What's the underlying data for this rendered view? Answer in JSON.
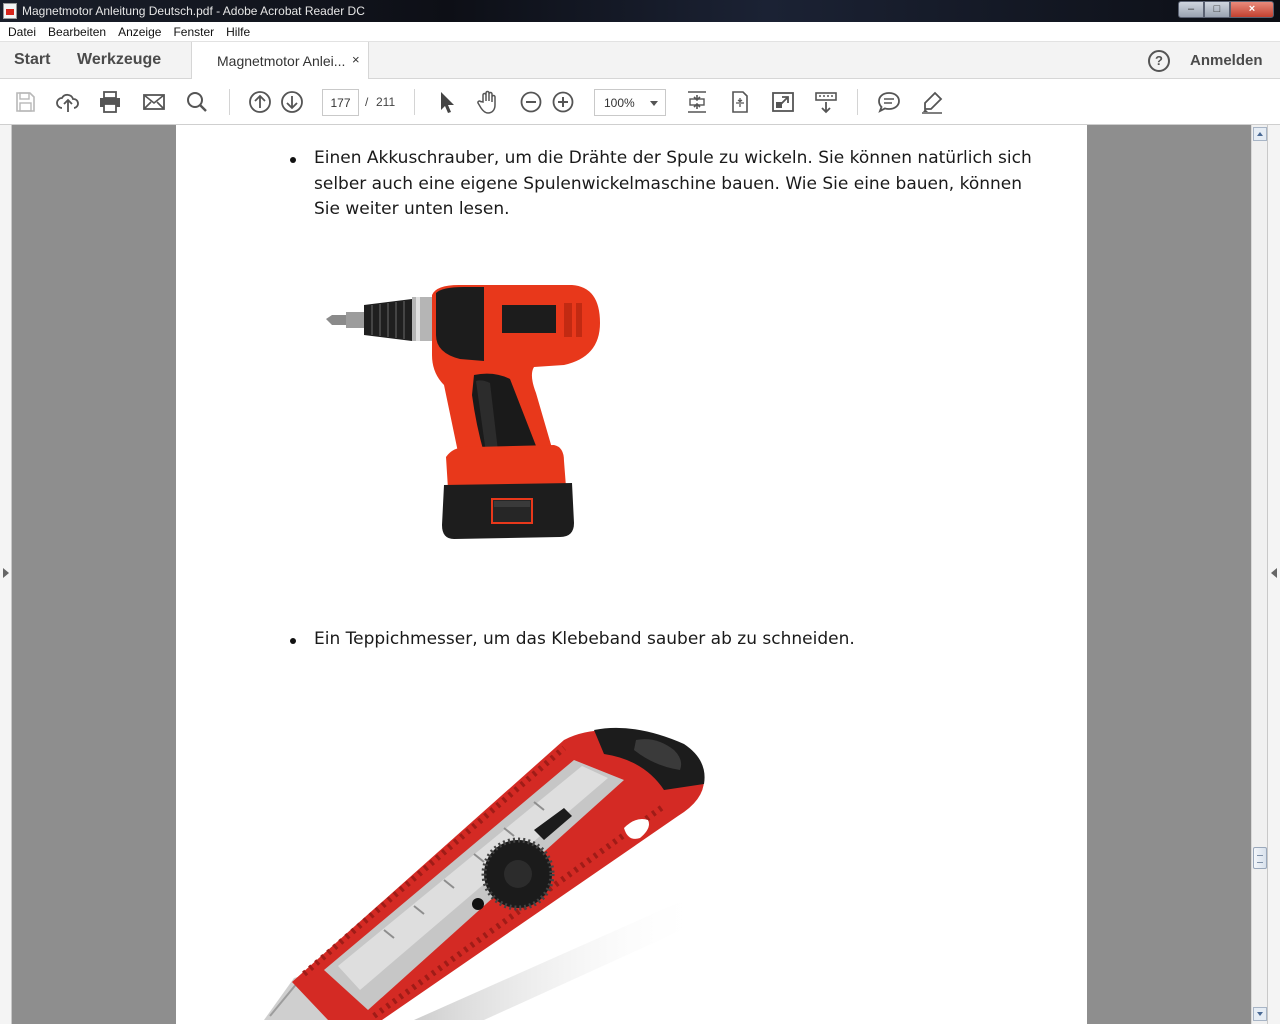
{
  "window": {
    "title": "Magnetmotor Anleitung Deutsch.pdf - Adobe Acrobat Reader DC",
    "buttons": {
      "minimize": "–",
      "maximize": "□",
      "close": "×"
    }
  },
  "menu": [
    "Datei",
    "Bearbeiten",
    "Anzeige",
    "Fenster",
    "Hilfe"
  ],
  "tabs": {
    "home": "Start",
    "tools": "Werkzeuge",
    "document": "Magnetmotor Anlei...",
    "close": "×"
  },
  "account": {
    "help": "?",
    "signin": "Anmelden"
  },
  "toolbar": {
    "icons": [
      "save-icon",
      "upload-icon",
      "print-icon",
      "email-icon",
      "search-icon",
      "page-up-icon",
      "page-down-icon",
      "select-cursor-icon",
      "hand-icon",
      "zoom-out-icon",
      "zoom-in-icon",
      "fit-page-icon",
      "fit-width-icon",
      "full-screen-icon",
      "scroll-mode-icon",
      "comment-icon",
      "highlight-icon"
    ],
    "current_page": "177",
    "page_separator": "/",
    "total_pages": "211",
    "zoom": "100%"
  },
  "document": {
    "paragraph1": "Einen Akkuschrauber, um die Drähte der Spule zu wickeln. Sie können natürlich sich selber auch eine eigene Spulenwickelmaschine bauen. Wie Sie eine bauen, können Sie weiter unten lesen.",
    "paragraph1_lines": [
      "Einen Akkuschrauber, um die Drähte der Spule zu wickeln. Sie können natürlich sich",
      "selber auch eine eigene Spulenwickelmaschine bauen. Wie Sie eine bauen, können",
      "Sie weiter unten lesen."
    ],
    "paragraph2": "Ein Teppichmesser, um das Klebeband sauber ab zu schneiden.",
    "images": [
      "cordless-drill",
      "utility-knife"
    ]
  },
  "colors": {
    "drill_accent": "#e8381b",
    "cutter_accent": "#d42a24",
    "viewer_bg": "#8e8e8e"
  }
}
